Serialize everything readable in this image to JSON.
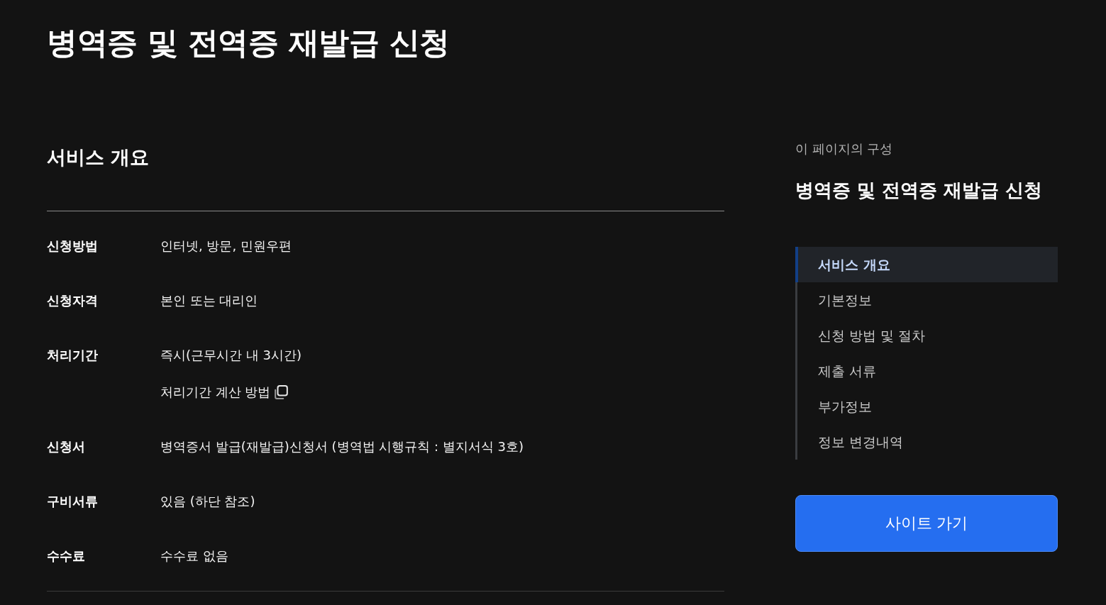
{
  "page": {
    "title": "병역증 및 전역증 재발급 신청"
  },
  "overview": {
    "heading": "서비스 개요",
    "rows": [
      {
        "label": "신청방법",
        "values": [
          {
            "kind": "text",
            "text": "인터넷, 방문, 민원우편"
          }
        ]
      },
      {
        "label": "신청자격",
        "values": [
          {
            "kind": "text",
            "text": "본인 또는 대리인"
          }
        ]
      },
      {
        "label": "처리기간",
        "values": [
          {
            "kind": "text",
            "text": "즉시(근무시간 내 3시간)"
          },
          {
            "kind": "link",
            "text": "처리기간 계산 방법"
          }
        ]
      },
      {
        "label": "신청서",
        "values": [
          {
            "kind": "text",
            "text": "병역증서 발급(재발급)신청서 (병역법 시행규칙 : 별지서식 3호)"
          }
        ]
      },
      {
        "label": "구비서류",
        "values": [
          {
            "kind": "text",
            "text": "있음 (하단 참조)"
          }
        ]
      },
      {
        "label": "수수료",
        "values": [
          {
            "kind": "text",
            "text": "수수료 없음"
          }
        ]
      }
    ]
  },
  "toc": {
    "caption": "이 페이지의 구성",
    "title": "병역증 및 전역증 재발급 신청",
    "items": [
      {
        "label": "서비스 개요",
        "selected": true
      },
      {
        "label": "기본정보",
        "selected": false
      },
      {
        "label": "신청 방법 및 절차",
        "selected": false
      },
      {
        "label": "제출 서류",
        "selected": false
      },
      {
        "label": "부가정보",
        "selected": false
      },
      {
        "label": "정보 변경내역",
        "selected": false
      }
    ]
  },
  "site_button": {
    "label": "사이트 가기"
  }
}
